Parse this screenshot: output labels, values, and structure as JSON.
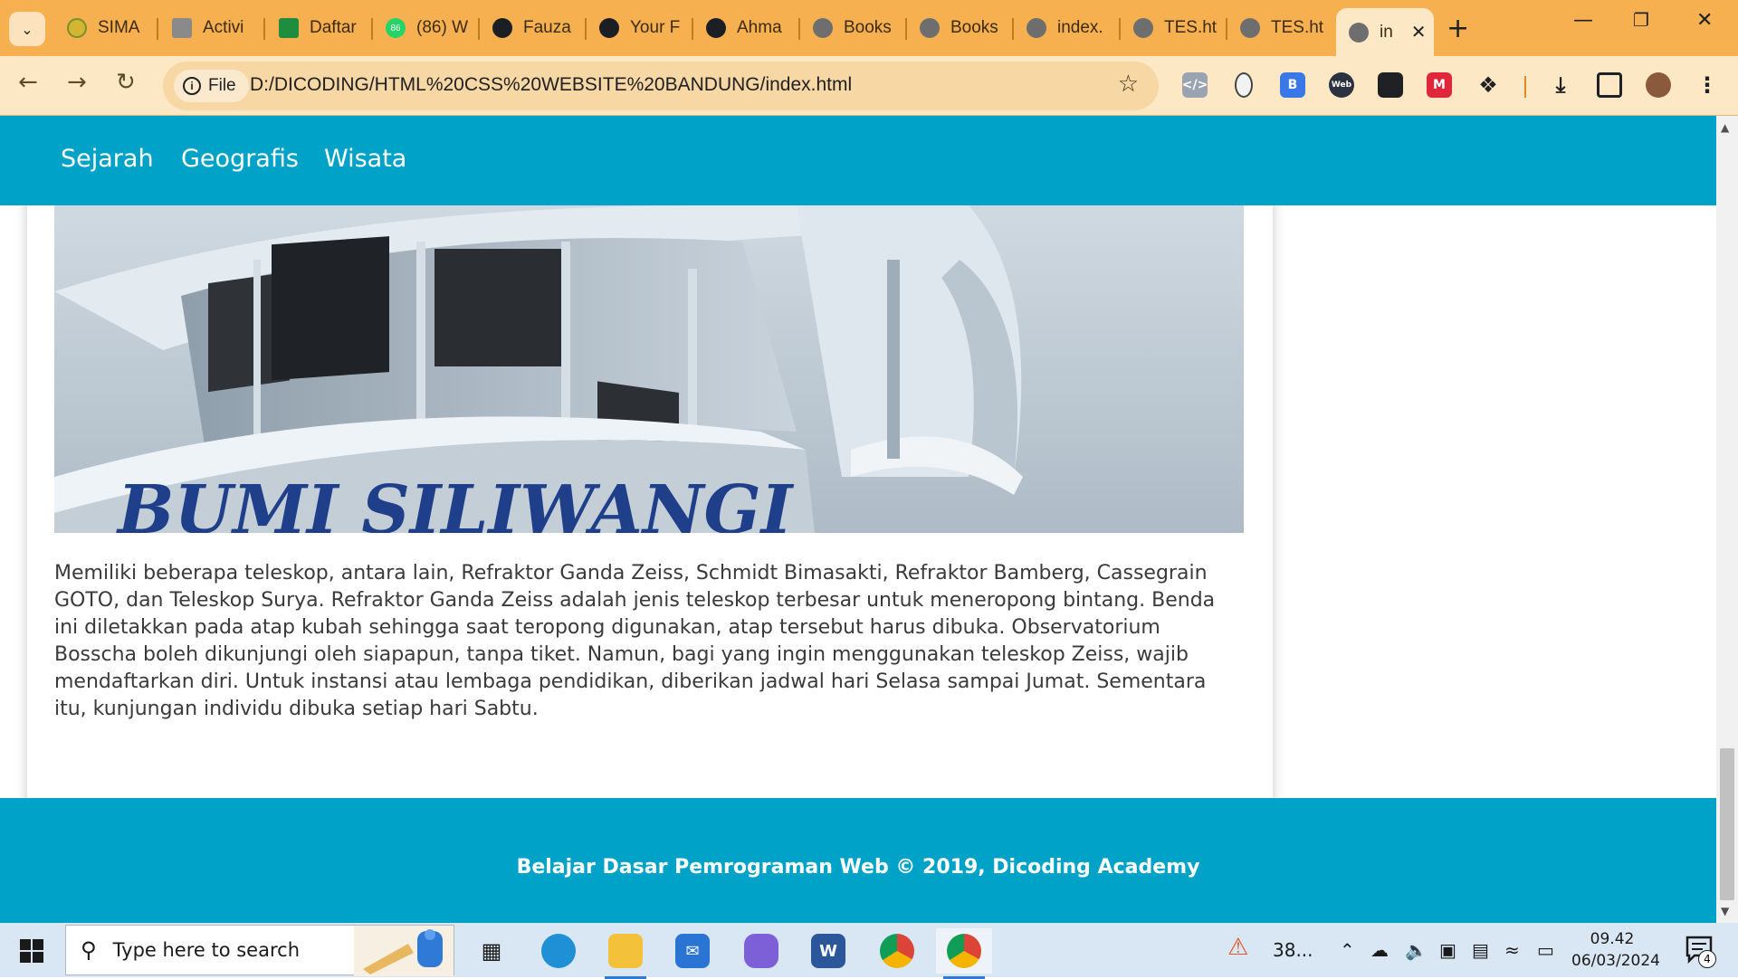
{
  "browser": {
    "tabs": [
      {
        "label": "SIMA",
        "favicon": "sima-icon",
        "color": "#7a8f2b"
      },
      {
        "label": "Activi",
        "favicon": "activity-icon",
        "color": "#555555"
      },
      {
        "label": "Daftar",
        "favicon": "classroom-icon",
        "color": "#1e8e3e"
      },
      {
        "label": "(86) W",
        "favicon": "whatsapp-icon",
        "color": "#25d366"
      },
      {
        "label": "Fauza",
        "favicon": "github-icon",
        "color": "#1b1f23"
      },
      {
        "label": "Your F",
        "favicon": "github-icon",
        "color": "#1b1f23"
      },
      {
        "label": "Ahma",
        "favicon": "github-icon",
        "color": "#1b1f23"
      },
      {
        "label": "Books",
        "favicon": "globe-icon",
        "color": "#6e6e6e"
      },
      {
        "label": "Books",
        "favicon": "globe-icon",
        "color": "#6e6e6e"
      },
      {
        "label": "index.",
        "favicon": "globe-icon",
        "color": "#6e6e6e"
      },
      {
        "label": "TES.ht",
        "favicon": "globe-icon",
        "color": "#6e6e6e"
      },
      {
        "label": "TES.ht",
        "favicon": "globe-icon",
        "color": "#6e6e6e"
      }
    ],
    "active_tab": {
      "label": "in",
      "favicon": "globe-icon"
    },
    "whatsapp_badge": "86",
    "file_chip": "File",
    "url": "D:/DICODING/HTML%20CSS%20WEBSITE%20BANDUNG/index.html",
    "colors": {
      "frame": "#f6b04f",
      "toolbar": "#fde8c6"
    }
  },
  "site": {
    "nav": [
      "Sejarah",
      "Geografis",
      "Wisata"
    ],
    "image_caption_partial": "BUMI SILIWANGI",
    "article_text": "Memiliki beberapa teleskop, antara lain, Refraktor Ganda Zeiss, Schmidt Bimasakti, Refraktor Bamberg, Cassegrain GOTO, dan Teleskop Surya. Refraktor Ganda Zeiss adalah jenis teleskop terbesar untuk meneropong bintang. Benda ini diletakkan pada atap kubah sehingga saat teropong digunakan, atap tersebut harus dibuka. Observatorium Bosscha boleh dikunjungi oleh siapapun, tanpa tiket. Namun, bagi yang ingin menggunakan teleskop Zeiss, wajib mendaftarkan diri. Untuk instansi atau lembaga pendidikan, diberikan jadwal hari Selasa sampai Jumat. Sementara itu, kunjungan individu dibuka setiap hari Sabtu.",
    "footer": "Belajar Dasar Pemrograman Web © 2019, Dicoding Academy",
    "colors": {
      "accent": "#00a2c7",
      "text": "#3a3a3a"
    }
  },
  "taskbar": {
    "search_placeholder": "Type here to search",
    "weather": "38...",
    "time": "09.42",
    "date": "06/03/2024",
    "notification_count": "4"
  }
}
